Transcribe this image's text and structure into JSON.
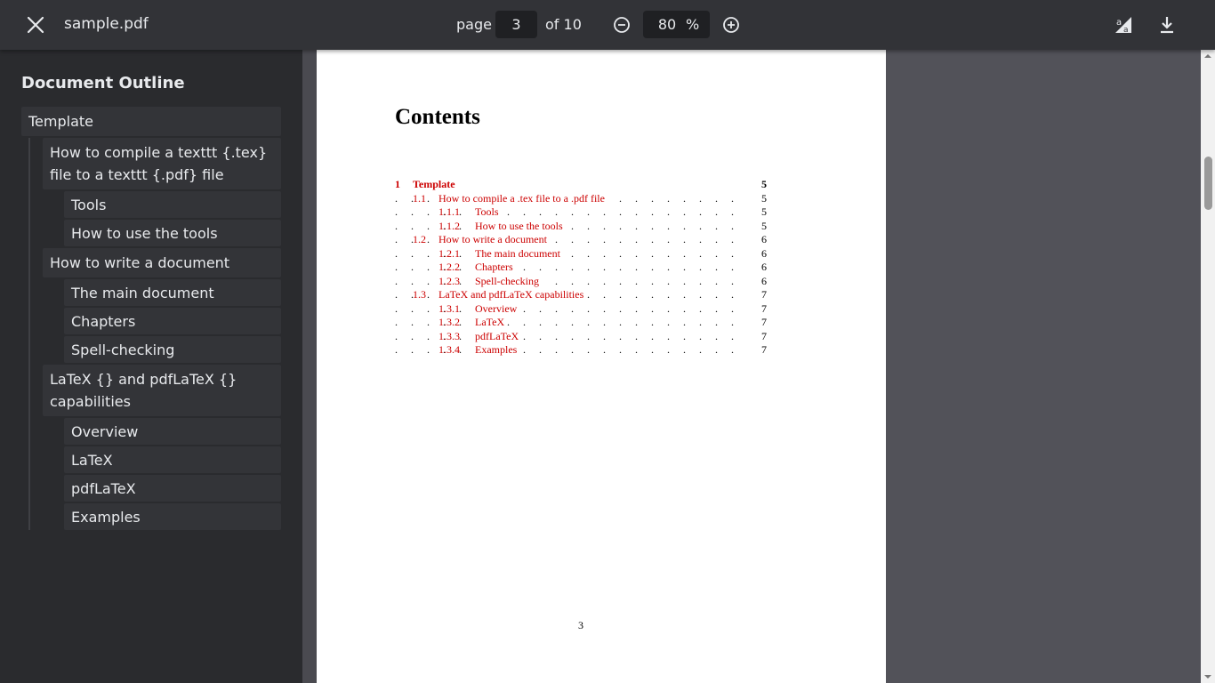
{
  "toolbar": {
    "file_name": "sample.pdf",
    "page_label": "page",
    "current_page": "3",
    "page_total_text": "of 10",
    "zoom_value": "80",
    "zoom_unit": "%"
  },
  "sidebar": {
    "title": "Document Outline",
    "outline": {
      "root": "Template",
      "sections": [
        {
          "label": "How to compile a texttt {.tex} file to a texttt {.pdf} file",
          "children": [
            "Tools",
            "How to use the tools"
          ]
        },
        {
          "label": "How to write a document",
          "children": [
            "The main document",
            "Chapters",
            "Spell-checking"
          ]
        },
        {
          "label": "LaTeX {} and pdfLaTeX {} capabilities",
          "children": [
            "Overview",
            "LaTeX",
            "pdfLaTeX",
            "Examples"
          ]
        }
      ]
    }
  },
  "document": {
    "heading": "Contents",
    "toc": [
      {
        "num": "1",
        "label": "Template",
        "page": "5",
        "level": 0
      },
      {
        "num": "1.1",
        "label": "How to compile a .tex file to a .pdf file",
        "page": "5",
        "level": 1
      },
      {
        "num": "1.1.1",
        "label": "Tools",
        "page": "5",
        "level": 2
      },
      {
        "num": "1.1.2",
        "label": "How to use the tools",
        "page": "5",
        "level": 2
      },
      {
        "num": "1.2",
        "label": "How to write a document",
        "page": "6",
        "level": 1
      },
      {
        "num": "1.2.1",
        "label": "The main document",
        "page": "6",
        "level": 2
      },
      {
        "num": "1.2.2",
        "label": "Chapters",
        "page": "6",
        "level": 2
      },
      {
        "num": "1.2.3",
        "label": "Spell-checking",
        "page": "6",
        "level": 2
      },
      {
        "num": "1.3",
        "label": "LaTeX and pdfLaTeX capabilities",
        "page": "7",
        "level": 1
      },
      {
        "num": "1.3.1",
        "label": "Overview",
        "page": "7",
        "level": 2
      },
      {
        "num": "1.3.2",
        "label": "LaTeX",
        "page": "7",
        "level": 2
      },
      {
        "num": "1.3.3",
        "label": "pdfLaTeX",
        "page": "7",
        "level": 2
      },
      {
        "num": "1.3.4",
        "label": "Examples",
        "page": "7",
        "level": 2
      }
    ],
    "page_number": "3"
  },
  "colors": {
    "toolbar_bg": "#323337",
    "sidebar_bg": "#2a2b2e",
    "viewer_bg": "#525259",
    "link_red": "#cc0000"
  },
  "icons": {
    "close": "close-icon",
    "zoom_out": "zoom-out-icon",
    "zoom_in": "zoom-in-icon",
    "translate": "translate-icon",
    "download": "download-icon"
  }
}
